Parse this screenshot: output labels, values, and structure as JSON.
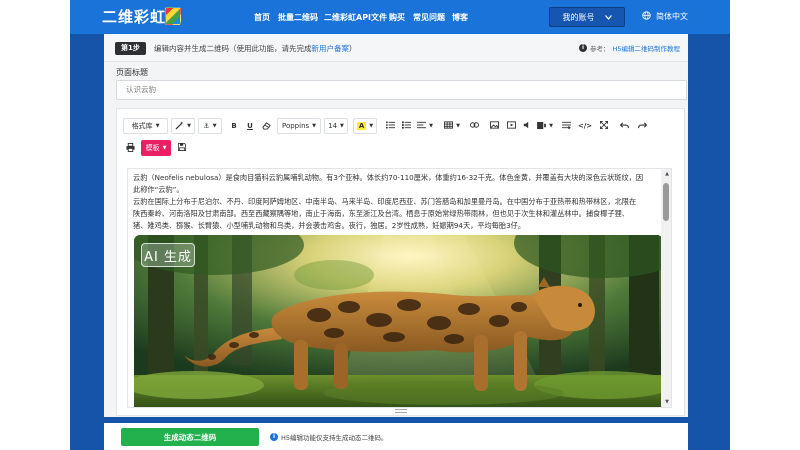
{
  "nav": {
    "logo": "二维彩虹",
    "items": [
      "首页",
      "批量二维码",
      "二维彩虹API文件",
      "购买",
      "常见问题",
      "博客"
    ],
    "account": "我的账号",
    "language": "简体中文"
  },
  "step": {
    "badge": "第1步",
    "text": "编辑内容并生成二维码（使用此功能，请先完成",
    "link": "新用户备案",
    "text_end": "）",
    "ref_label": "参考：",
    "ref_link": "H5编辑二维码制作教程"
  },
  "form": {
    "page_title_label": "页面标题",
    "page_title_value": "认识云豹"
  },
  "toolbar": {
    "format_lib": "格式库",
    "font": "Poppins",
    "size": "14",
    "template": "模板"
  },
  "content": {
    "lines": [
      "云豹（Neofelis nebulosa）是食肉目猫科云豹属哺乳动物。有3个亚种。体长约70-110厘米，体重约16-32千克。体色金黄，并覆盖有大块的深色云状斑纹，因",
      "此称作“云豹”。",
      "云豹在国际上分布于尼泊尔、不丹、印度阿萨姆地区、中南半岛、马来半岛、印度尼西亚、苏门答腊岛和加里曼丹岛。在中国分布于亚热带和热带林区，北限在",
      "陕西秦岭、河南洛阳及甘肃南部。西至西藏察隅等地，南止于海南，东至浙江及台湾。栖息于原始常绿热带雨林，但也见于次生林和灌丛林中。捕食椰子狸、",
      "猪、雉鸡类、猕猴、长臂猿、小型哺乳动物和鸟类，并会袭击鸡舍。夜行，独居。2岁性成熟，妊娠期94天，平均每胎3仔。"
    ],
    "image_badge": "AI 生成"
  },
  "bottom": {
    "generate_button": "生成动态二维码",
    "note": "H5编辑功能仅支持生成动态二维码。"
  },
  "colors": {
    "nav_bg": "#1a73d9",
    "stage_bg": "#1554a8",
    "generate_green": "#22b14c",
    "template_pink": "#e91e63",
    "link_blue": "#1a73d9"
  }
}
